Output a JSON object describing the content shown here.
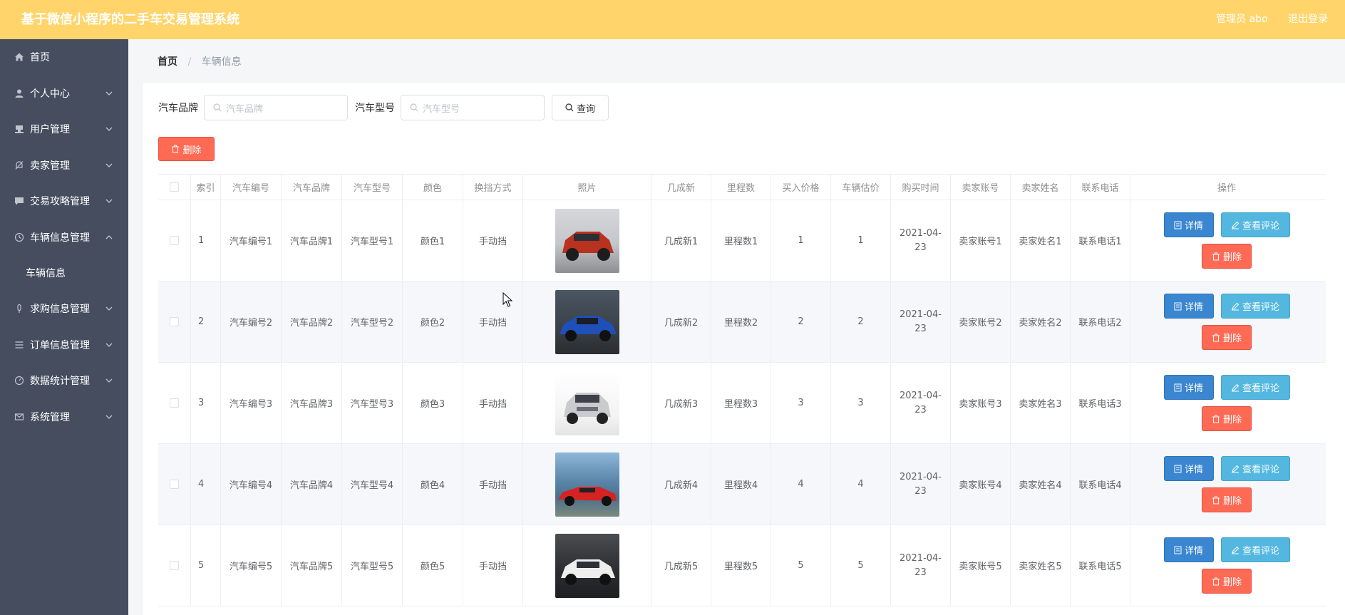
{
  "header": {
    "title": "基于微信小程序的二手车交易管理系统",
    "user": "管理员 abo",
    "logout": "退出登录"
  },
  "sidebar": {
    "items": [
      {
        "label": "首页",
        "icon": "home-icon",
        "chevron": false
      },
      {
        "label": "个人中心",
        "icon": "user-icon",
        "chevron": true
      },
      {
        "label": "用户管理",
        "icon": "stamp-icon",
        "chevron": true
      },
      {
        "label": "卖家管理",
        "icon": "bell-off-icon",
        "chevron": true
      },
      {
        "label": "交易攻略管理",
        "icon": "chat-icon",
        "chevron": true
      },
      {
        "label": "车辆信息管理",
        "icon": "clock-icon",
        "chevron": "up"
      },
      {
        "label": "车辆信息",
        "sub": true
      },
      {
        "label": "求购信息管理",
        "icon": "mic-icon",
        "chevron": true
      },
      {
        "label": "订单信息管理",
        "icon": "list-icon",
        "chevron": true
      },
      {
        "label": "数据统计管理",
        "icon": "gauge-icon",
        "chevron": true
      },
      {
        "label": "系统管理",
        "icon": "mail-icon",
        "chevron": true
      }
    ]
  },
  "breadcrumb": {
    "home": "首页",
    "separator": "/",
    "current": "车辆信息"
  },
  "search": {
    "brand_label": "汽车品牌",
    "brand_placeholder": "汽车品牌",
    "model_label": "汽车型号",
    "model_placeholder": "汽车型号",
    "query_label": "查询"
  },
  "toolbar": {
    "delete_label": "删除"
  },
  "table": {
    "headers": [
      "",
      "索引",
      "汽车编号",
      "汽车品牌",
      "汽车型号",
      "颜色",
      "换挡方式",
      "照片",
      "几成新",
      "里程数",
      "买入价格",
      "车辆估价",
      "购买时间",
      "卖家账号",
      "卖家姓名",
      "联系电话",
      "操作"
    ],
    "rows": [
      {
        "index": "1",
        "car_no": "汽车编号1",
        "brand": "汽车品牌1",
        "model": "汽车型号1",
        "color": "颜色1",
        "gear": "手动挡",
        "condition": "几成新1",
        "mileage": "里程数1",
        "buy_price": "1",
        "estimate": "1",
        "date": "2021-04-23",
        "seller_account": "卖家账号1",
        "seller_name": "卖家姓名1",
        "phone": "联系电话1"
      },
      {
        "index": "2",
        "car_no": "汽车编号2",
        "brand": "汽车品牌2",
        "model": "汽车型号2",
        "color": "颜色2",
        "gear": "手动挡",
        "condition": "几成新2",
        "mileage": "里程数2",
        "buy_price": "2",
        "estimate": "2",
        "date": "2021-04-23",
        "seller_account": "卖家账号2",
        "seller_name": "卖家姓名2",
        "phone": "联系电话2"
      },
      {
        "index": "3",
        "car_no": "汽车编号3",
        "brand": "汽车品牌3",
        "model": "汽车型号3",
        "color": "颜色3",
        "gear": "手动挡",
        "condition": "几成新3",
        "mileage": "里程数3",
        "buy_price": "3",
        "estimate": "3",
        "date": "2021-04-23",
        "seller_account": "卖家账号3",
        "seller_name": "卖家姓名3",
        "phone": "联系电话3"
      },
      {
        "index": "4",
        "car_no": "汽车编号4",
        "brand": "汽车品牌4",
        "model": "汽车型号4",
        "color": "颜色4",
        "gear": "手动挡",
        "condition": "几成新4",
        "mileage": "里程数4",
        "buy_price": "4",
        "estimate": "4",
        "date": "2021-04-23",
        "seller_account": "卖家账号4",
        "seller_name": "卖家姓名4",
        "phone": "联系电话4"
      },
      {
        "index": "5",
        "car_no": "汽车编号5",
        "brand": "汽车品牌5",
        "model": "汽车型号5",
        "color": "颜色5",
        "gear": "手动挡",
        "condition": "几成新5",
        "mileage": "里程数5",
        "buy_price": "5",
        "estimate": "5",
        "date": "2021-04-23",
        "seller_account": "卖家账号5",
        "seller_name": "卖家姓名5",
        "phone": "联系电话5"
      }
    ],
    "actions": {
      "detail": "详情",
      "comment": "查看评论",
      "delete": "删除"
    }
  },
  "colors": {
    "header_bg": "#ffd56b",
    "sidebar_bg": "#454d5f",
    "danger": "#ff6a55",
    "primary": "#3a86d0",
    "info": "#54b7e0"
  }
}
